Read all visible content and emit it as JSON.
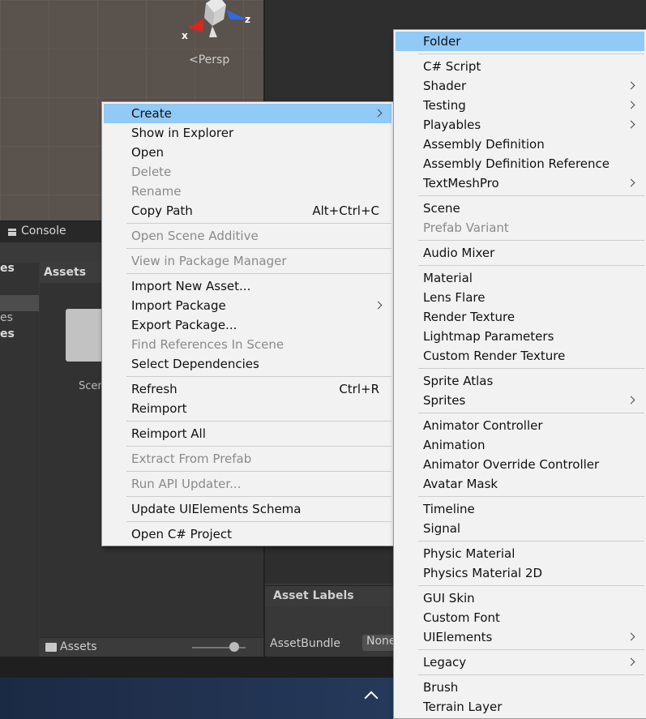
{
  "scene": {
    "persp_label": "Persp",
    "axis_x": "x",
    "axis_z": "z"
  },
  "console_tab": "Console",
  "project": {
    "left_partial_1": "es",
    "left_partial_2": "es",
    "left_partial_3": "es",
    "assets_title": "Assets",
    "folder_label": "Scen",
    "footer_path": "Assets"
  },
  "inspector": {
    "asset_labels": "Asset Labels",
    "assetbundle_label": "AssetBundle",
    "assetbundle_value": "None"
  },
  "main_menu": {
    "groups": [
      [
        {
          "label": "Create",
          "submenu": true,
          "highlighted": true
        },
        {
          "label": "Show in Explorer"
        },
        {
          "label": "Open"
        },
        {
          "label": "Delete",
          "disabled": true
        },
        {
          "label": "Rename",
          "disabled": true
        },
        {
          "label": "Copy Path",
          "shortcut": "Alt+Ctrl+C"
        }
      ],
      [
        {
          "label": "Open Scene Additive",
          "disabled": true
        }
      ],
      [
        {
          "label": "View in Package Manager",
          "disabled": true
        }
      ],
      [
        {
          "label": "Import New Asset..."
        },
        {
          "label": "Import Package",
          "submenu": true
        },
        {
          "label": "Export Package..."
        },
        {
          "label": "Find References In Scene",
          "disabled": true
        },
        {
          "label": "Select Dependencies"
        }
      ],
      [
        {
          "label": "Refresh",
          "shortcut": "Ctrl+R"
        },
        {
          "label": "Reimport"
        }
      ],
      [
        {
          "label": "Reimport All"
        }
      ],
      [
        {
          "label": "Extract From Prefab",
          "disabled": true
        }
      ],
      [
        {
          "label": "Run API Updater...",
          "disabled": true
        }
      ],
      [
        {
          "label": "Update UIElements Schema"
        }
      ],
      [
        {
          "label": "Open C# Project"
        }
      ]
    ]
  },
  "create_menu": {
    "groups": [
      [
        {
          "label": "Folder",
          "highlighted": true
        }
      ],
      [
        {
          "label": "C# Script"
        },
        {
          "label": "Shader",
          "submenu": true
        },
        {
          "label": "Testing",
          "submenu": true
        },
        {
          "label": "Playables",
          "submenu": true
        },
        {
          "label": "Assembly Definition"
        },
        {
          "label": "Assembly Definition Reference"
        },
        {
          "label": "TextMeshPro",
          "submenu": true
        }
      ],
      [
        {
          "label": "Scene"
        },
        {
          "label": "Prefab Variant",
          "disabled": true
        }
      ],
      [
        {
          "label": "Audio Mixer"
        }
      ],
      [
        {
          "label": "Material"
        },
        {
          "label": "Lens Flare"
        },
        {
          "label": "Render Texture"
        },
        {
          "label": "Lightmap Parameters"
        },
        {
          "label": "Custom Render Texture"
        }
      ],
      [
        {
          "label": "Sprite Atlas"
        },
        {
          "label": "Sprites",
          "submenu": true
        }
      ],
      [
        {
          "label": "Animator Controller"
        },
        {
          "label": "Animation"
        },
        {
          "label": "Animator Override Controller"
        },
        {
          "label": "Avatar Mask"
        }
      ],
      [
        {
          "label": "Timeline"
        },
        {
          "label": "Signal"
        }
      ],
      [
        {
          "label": "Physic Material"
        },
        {
          "label": "Physics Material 2D"
        }
      ],
      [
        {
          "label": "GUI Skin"
        },
        {
          "label": "Custom Font"
        },
        {
          "label": "UIElements",
          "submenu": true
        }
      ],
      [
        {
          "label": "Legacy",
          "submenu": true
        }
      ],
      [
        {
          "label": "Brush"
        },
        {
          "label": "Terrain Layer"
        }
      ]
    ]
  },
  "colors": {
    "menu_bg": "#f2f2f2",
    "highlight": "#91c9f7",
    "disabled_text": "#8a8a8a"
  }
}
